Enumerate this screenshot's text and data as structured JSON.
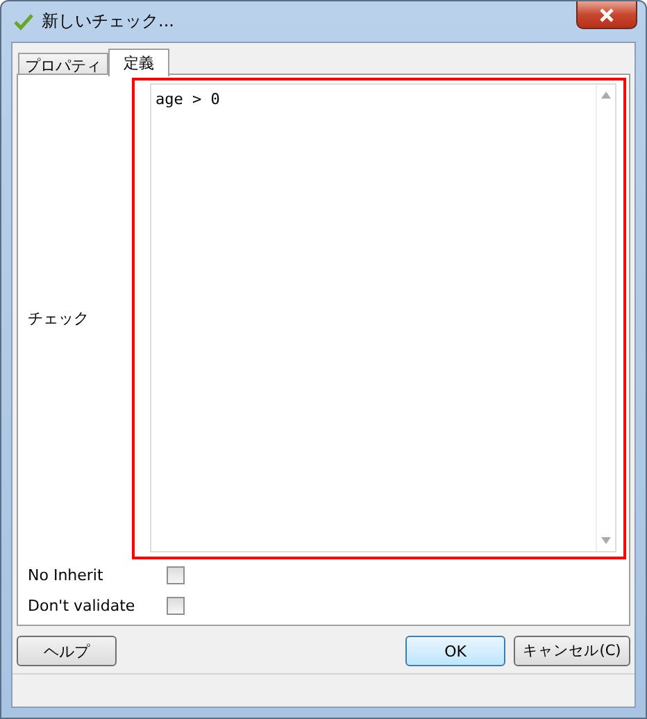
{
  "window": {
    "title": "新しいチェック..."
  },
  "tabs": [
    {
      "label": "プロパティ",
      "selected": false
    },
    {
      "label": "定義",
      "selected": true
    }
  ],
  "check": {
    "label": "チェック",
    "value": "age > 0"
  },
  "options": [
    {
      "label": "No Inherit",
      "checked": false
    },
    {
      "label": "Don't validate",
      "checked": false
    }
  ],
  "buttons": {
    "help": "ヘルプ",
    "ok": "OK",
    "cancel": "キャンセル(C)"
  }
}
